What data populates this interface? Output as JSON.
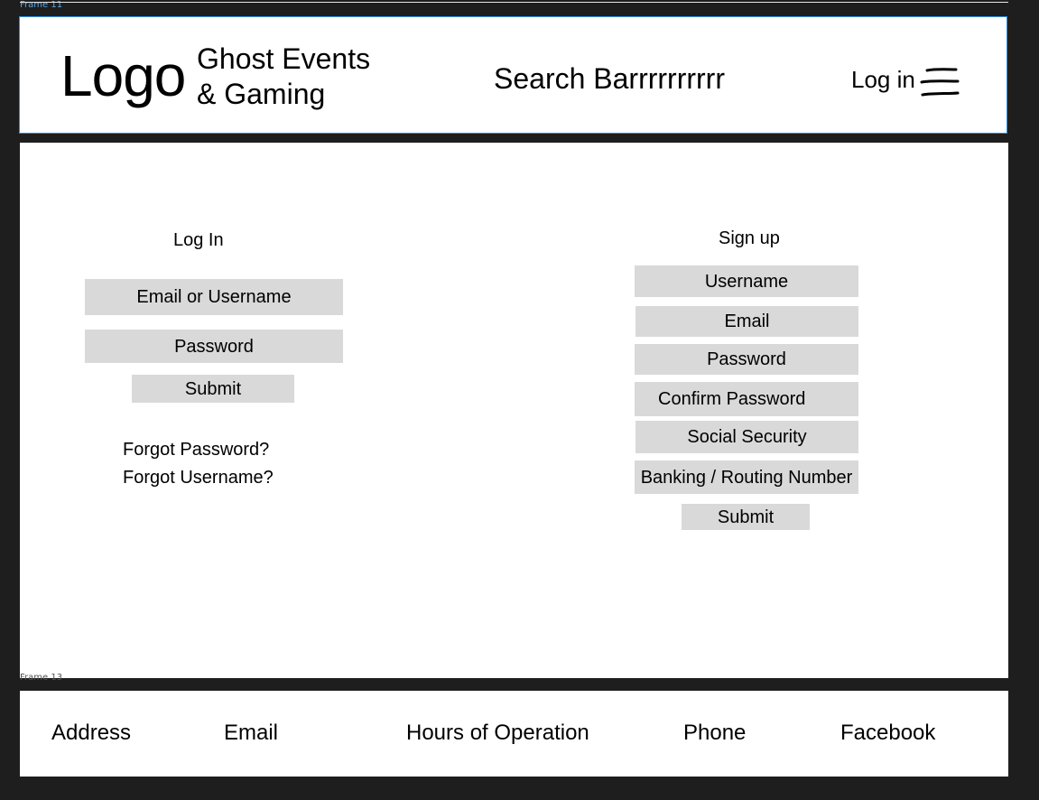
{
  "canvas": {
    "frame_label_top": "Frame 11",
    "frame_label_bottom": "Frame 13"
  },
  "header": {
    "logo": "Logo",
    "brand_line1": "Ghost Events",
    "brand_line2": "& Gaming",
    "search": "Search Barrrrrrrrrr",
    "login": "Log in",
    "menu_icon": "hamburger-menu-icon"
  },
  "login_form": {
    "title": "Log In",
    "email_or_username": "Email or Username",
    "password": "Password",
    "submit": "Submit",
    "forgot_password": "Forgot Password?",
    "forgot_username": "Forgot Username?"
  },
  "signup_form": {
    "title": "Sign up",
    "username": "Username",
    "email": "Email",
    "password": "Password",
    "confirm_password": "Confirm Password",
    "social_security": "Social Security",
    "banking": "Banking / Routing Number",
    "submit": "Submit"
  },
  "footer": {
    "address": "Address",
    "email": "Email",
    "hours": "Hours of Operation",
    "phone": "Phone",
    "facebook": "Facebook"
  },
  "colors": {
    "background": "#1e1e1e",
    "frame_selection": "#2f8de4",
    "field_fill": "#d9d9d9"
  }
}
